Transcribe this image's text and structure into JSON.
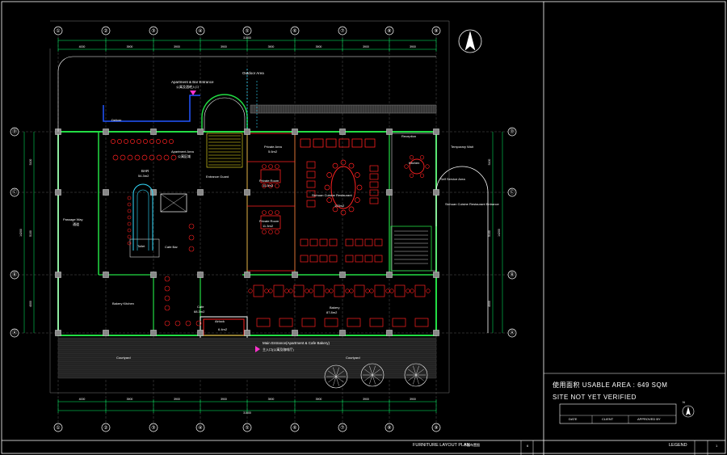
{
  "grid": {
    "columns": [
      "①",
      "②",
      "③",
      "④",
      "⑤",
      "⑥",
      "⑦",
      "⑧",
      "⑨"
    ],
    "rows": [
      "Ⓓ",
      "Ⓒ",
      "Ⓑ",
      "Ⓐ"
    ],
    "dims_top": [
      "4000",
      "3900",
      "3900",
      "3900",
      "3900",
      "3900",
      "3900",
      "3900"
    ],
    "total_width": "31500",
    "dims_left": [
      "5100",
      "5100",
      "4000"
    ],
    "total_height": "14200"
  },
  "rooms": {
    "apartment_bar_entrance": "Apartment & Bar Entrance",
    "apartment_bar_entrance_cn": "公寓及酒吧入口",
    "outdoor_area": "Outdoor Area",
    "deliver": "Deliver",
    "apartment_area": "Apartment Area",
    "apartment_area_cn": "公寓区域",
    "bar": "BAR",
    "bar_area": "54.3m2",
    "entrance_guard": "Entrance Guard",
    "private_area": "Private Area",
    "private_area_size": "5.6m2",
    "private_room_1": "Private Room",
    "private_room_1_size": "11.3m2",
    "private_room_2": "Private Room",
    "private_room_2_size": "11.3m2",
    "sichuan_cuisine": "Sichuan Cuisine Restaurant",
    "sichuan_cuisine_size": "103m2",
    "passage_way": "Passage Way",
    "passage_way_cn": "通道",
    "toilet": "Toilet",
    "cafe_bar": "Cafe Bar",
    "bakery_kitchen": "Bakery Kitchen",
    "cafe": "Cafe",
    "cafe_size": "68.3m2",
    "airlock": "Airlock",
    "airlock_size": "6.4m2",
    "bakery": "Bakery",
    "bakery_size": "87.8m2",
    "main_entrance": "Main Entrance(Apartment & Cafe Bakery)",
    "main_entrance_cn": "主入口(公寓及咖啡厅)",
    "courtyard_left": "Courtyard",
    "courtyard_right": "Courtyard",
    "temporary_wait": "Temporary Wait",
    "self_service": "Self Service Area",
    "sichuan_entrance": "Sichuan Cuisine Restaurant Entrance",
    "reception": "Reception",
    "kitchen": "Kitchen"
  },
  "title_block": {
    "usable_area": "使用面积 USABLE AREA : 649 SQM",
    "site_status": "SITE NOT YET VERIFIED",
    "date_label": "DATE",
    "client_label": "CLIENT",
    "approved_label": "APPROVED BY",
    "drawing_title": "FURNITURE LAYOUT PLAN",
    "drawing_title_cn": "平面布置图",
    "sheet_no": "6",
    "legend": "LEGEND",
    "legend_sheet": "1"
  },
  "north": "N"
}
